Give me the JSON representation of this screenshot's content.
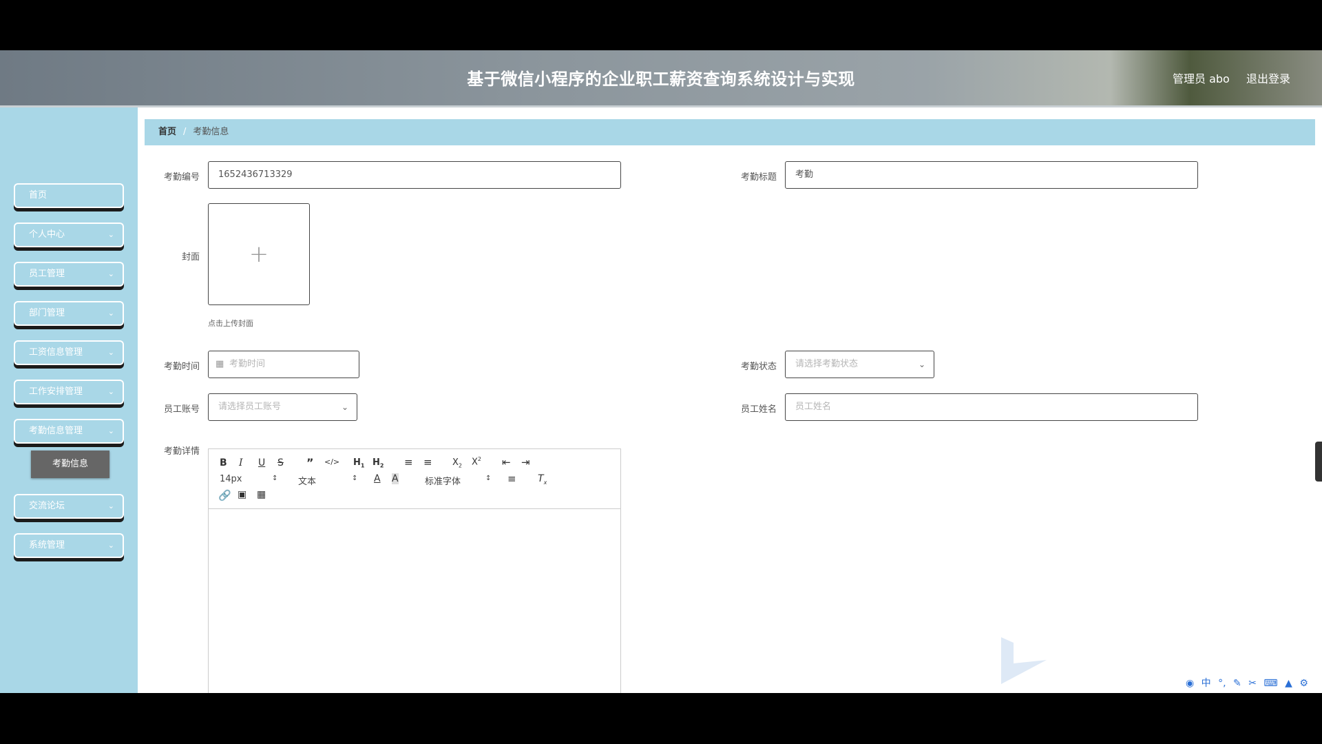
{
  "header": {
    "title": "基于微信小程序的企业职工薪资查询系统设计与实现",
    "user": "管理员 abo",
    "logout": "退出登录"
  },
  "sidebar": {
    "items": [
      {
        "label": "首页",
        "has_chevron": false
      },
      {
        "label": "个人中心",
        "has_chevron": true
      },
      {
        "label": "员工管理",
        "has_chevron": true
      },
      {
        "label": "部门管理",
        "has_chevron": true
      },
      {
        "label": "工资信息管理",
        "has_chevron": true
      },
      {
        "label": "工作安排管理",
        "has_chevron": true
      },
      {
        "label": "考勤信息管理",
        "has_chevron": true
      },
      {
        "label": "交流论坛",
        "has_chevron": true
      },
      {
        "label": "系统管理",
        "has_chevron": true
      }
    ],
    "active_subitem": "考勤信息"
  },
  "breadcrumb": {
    "home": "首页",
    "separator": "/",
    "current": "考勤信息"
  },
  "form": {
    "id_label": "考勤编号",
    "id_value": "1652436713329",
    "title_label": "考勤标题",
    "title_value": "考勤",
    "cover_label": "封面",
    "cover_hint": "点击上传封面",
    "time_label": "考勤时间",
    "time_placeholder": "考勤时间",
    "status_label": "考勤状态",
    "status_placeholder": "请选择考勤状态",
    "account_label": "员工账号",
    "account_placeholder": "请选择员工账号",
    "name_label": "员工姓名",
    "name_placeholder": "员工姓名",
    "detail_label": "考勤详情"
  },
  "editor": {
    "font_size": "14px",
    "header_select": "文本",
    "font_family": "标准字体"
  },
  "tray": {
    "ime_mode": "中"
  },
  "colors": {
    "sidebar_bg": "#a9d7e7",
    "breadcrumb_bg": "#a9d7e7",
    "active_subitem_bg": "#666666"
  }
}
